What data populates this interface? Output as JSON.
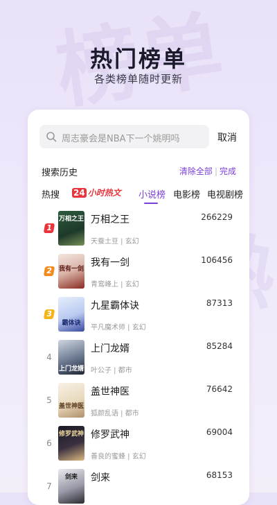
{
  "header": {
    "title": "热门榜单",
    "subtitle": "各类榜单随时更新"
  },
  "search": {
    "placeholder": "周志豪会是NBA下一个姚明吗",
    "cancel_label": "取消"
  },
  "history": {
    "label": "搜索历史",
    "clear_label": "清除全部",
    "separator": "|",
    "done_label": "完成"
  },
  "tabs": [
    {
      "label": "热搜"
    },
    {
      "num": "24",
      "label": "小时热文"
    },
    {
      "label": "小说榜"
    },
    {
      "label": "电影榜"
    },
    {
      "label": "电视剧榜"
    }
  ],
  "colors": {
    "accent": "#7a3fd8",
    "rank1": "#e8343a",
    "rank2": "#f28a1d",
    "rank3": "#f5b516"
  },
  "books": [
    {
      "rank": "1",
      "title": "万相之王",
      "author": "天蚕土豆",
      "genre": "玄幻",
      "count": "266229",
      "cover_text": "万相之王"
    },
    {
      "rank": "2",
      "title": "我有一剑",
      "author": "青鸾峰上",
      "genre": "玄幻",
      "count": "106456",
      "cover_text": "我有一剑"
    },
    {
      "rank": "3",
      "title": "九星霸体诀",
      "author": "平凡魔术师",
      "genre": "玄幻",
      "count": "87313",
      "cover_text": "霸体诀"
    },
    {
      "rank": "4",
      "title": "上门龙婿",
      "author": "叶公子",
      "genre": "都市",
      "count": "85284",
      "cover_text": "上门龙婿"
    },
    {
      "rank": "5",
      "title": "盖世神医",
      "author": "狐颜乱语",
      "genre": "都市",
      "count": "76642",
      "cover_text": "盖世神医"
    },
    {
      "rank": "6",
      "title": "修罗武神",
      "author": "善良的蜜蜂",
      "genre": "玄幻",
      "count": "69004",
      "cover_text": "修罗武神"
    },
    {
      "rank": "7",
      "title": "剑来",
      "author": "",
      "genre": "",
      "count": "68153",
      "cover_text": "剑来"
    }
  ]
}
